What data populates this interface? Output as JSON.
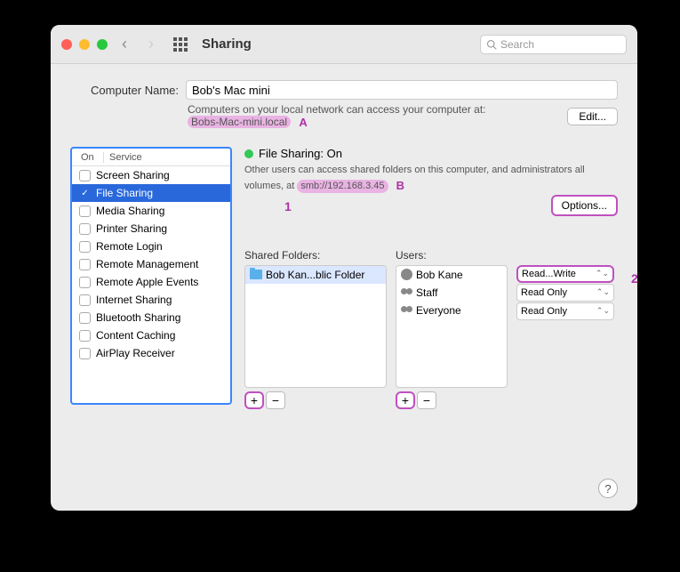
{
  "titlebar": {
    "title": "Sharing",
    "search_placeholder": "Search"
  },
  "computer_name": {
    "label": "Computer Name:",
    "value": "Bob's Mac mini",
    "subtext_prefix": "Computers on your local network can access your computer at:",
    "hostname": "Bobs-Mac-mini.local",
    "edit_label": "Edit..."
  },
  "services": {
    "header_on": "On",
    "header_service": "Service",
    "items": [
      {
        "label": "Screen Sharing",
        "checked": false,
        "selected": false
      },
      {
        "label": "File Sharing",
        "checked": true,
        "selected": true
      },
      {
        "label": "Media Sharing",
        "checked": false,
        "selected": false
      },
      {
        "label": "Printer Sharing",
        "checked": false,
        "selected": false
      },
      {
        "label": "Remote Login",
        "checked": false,
        "selected": false
      },
      {
        "label": "Remote Management",
        "checked": false,
        "selected": false
      },
      {
        "label": "Remote Apple Events",
        "checked": false,
        "selected": false
      },
      {
        "label": "Internet Sharing",
        "checked": false,
        "selected": false
      },
      {
        "label": "Bluetooth Sharing",
        "checked": false,
        "selected": false
      },
      {
        "label": "Content Caching",
        "checked": false,
        "selected": false
      },
      {
        "label": "AirPlay Receiver",
        "checked": false,
        "selected": false
      }
    ]
  },
  "detail": {
    "status_title": "File Sharing: On",
    "desc_prefix": "Other users can access shared folders on this computer, and administrators all volumes, at ",
    "smb_address": "smb://192.168.3.45",
    "options_label": "Options..."
  },
  "shared_folders": {
    "label": "Shared Folders:",
    "items": [
      {
        "label": "Bob Kan...blic Folder",
        "selected": true
      }
    ]
  },
  "users": {
    "label": "Users:",
    "items": [
      {
        "label": "Bob Kane",
        "icon": "user",
        "perm": "Read...Write",
        "boxed": true
      },
      {
        "label": "Staff",
        "icon": "group",
        "perm": "Read Only",
        "boxed": false
      },
      {
        "label": "Everyone",
        "icon": "group",
        "perm": "Read Only",
        "boxed": false
      }
    ]
  },
  "buttons": {
    "plus": "+",
    "minus": "−"
  },
  "annotations": {
    "a": "A",
    "b": "B",
    "one": "1",
    "two": "2"
  },
  "help": "?"
}
